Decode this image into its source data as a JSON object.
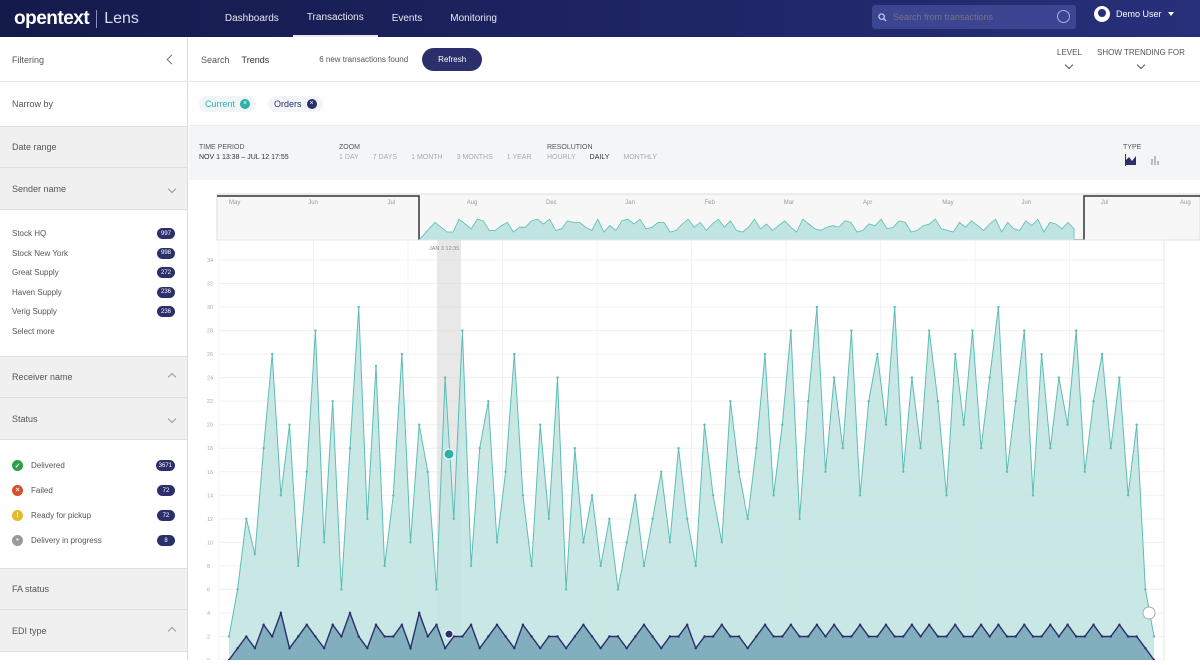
{
  "app": {
    "brand": "opentext",
    "product": "Lens"
  },
  "nav": {
    "items": [
      "Dashboards",
      "Transactions",
      "Events",
      "Monitoring"
    ],
    "active": 1
  },
  "search": {
    "placeholder": "Search from transactions"
  },
  "user": {
    "name": "Demo User"
  },
  "sidebar": {
    "title": "Filtering",
    "narrow_by": "Narrow by",
    "date_range": "Date range",
    "sender_name": "Sender name",
    "senders": [
      {
        "label": "Stock HQ",
        "count": "997"
      },
      {
        "label": "Stock New York",
        "count": "998"
      },
      {
        "label": "Great Supply",
        "count": "272"
      },
      {
        "label": "Haven Supply",
        "count": "236"
      },
      {
        "label": "Verig Supply",
        "count": "236"
      },
      {
        "label": "Select more",
        "count": ""
      }
    ],
    "receiver_name": "Receiver name",
    "status_title": "Status",
    "statuses": [
      {
        "label": "Delivered",
        "count": "3671",
        "color": "#2e9e47",
        "icon": "check-icon"
      },
      {
        "label": "Failed",
        "count": "72",
        "color": "#d9502f",
        "icon": "x-icon"
      },
      {
        "label": "Ready for pickup",
        "count": "72",
        "color": "#e6b82e",
        "icon": "info-icon"
      },
      {
        "label": "Delivery in progress",
        "count": "8",
        "color": "#9a9a9a",
        "icon": "progress-icon"
      }
    ],
    "fa_status": "FA status",
    "edi_type": "EDI type"
  },
  "toolbar": {
    "tabs": [
      "Search",
      "Trends"
    ],
    "new_transactions": "6 new transactions found",
    "refresh": "Refresh",
    "level": "LEVEL",
    "show_trending": "SHOW TRENDING FOR"
  },
  "filters": [
    {
      "label": "Current",
      "color": "#2fb0a8"
    },
    {
      "label": "Orders",
      "color": "#2b2f6b"
    }
  ],
  "controls": {
    "time_period_label": "TIME PERIOD",
    "time_period_value": "NOV 1 13:38 – JUL 12 17:55",
    "zoom_label": "ZOOM",
    "zoom_options": [
      "1 DAY",
      "7 DAYS",
      "1 MONTH",
      "3 MONTHS",
      "1 YEAR"
    ],
    "resolution_label": "RESOLUTION",
    "resolution_options": [
      "HOURLY",
      "DAILY",
      "MONTHLY"
    ],
    "resolution_selected": 1,
    "type_label": "TYPE"
  },
  "chart_data": {
    "type": "area",
    "overview_months": [
      "May",
      "Jun",
      "Jul",
      "Aug",
      "Dec",
      "Jan",
      "Feb",
      "Mar",
      "Apr",
      "May",
      "Jun",
      "Jul",
      "Aug"
    ],
    "cursor_label": "JAN 3 12:35",
    "ylim": [
      0,
      34
    ],
    "y_ticks": [
      0,
      2,
      4,
      6,
      8,
      10,
      12,
      14,
      16,
      18,
      20,
      22,
      24,
      26,
      28,
      30,
      32,
      34
    ],
    "series": [
      {
        "color": "#5dbdb5",
        "fill": "#bfe4e1",
        "values": [
          2,
          6,
          12,
          9,
          18,
          26,
          14,
          20,
          8,
          16,
          28,
          10,
          22,
          6,
          18,
          30,
          12,
          25,
          8,
          14,
          26,
          10,
          20,
          16,
          6,
          24,
          12,
          28,
          8,
          18,
          22,
          10,
          16,
          26,
          14,
          8,
          20,
          12,
          24,
          6,
          18,
          10,
          14,
          8,
          12,
          6,
          10,
          14,
          8,
          12,
          16,
          10,
          18,
          12,
          8,
          20,
          14,
          10,
          22,
          16,
          12,
          18,
          26,
          14,
          20,
          28,
          12,
          22,
          30,
          16,
          24,
          18,
          28,
          14,
          22,
          26,
          20,
          30,
          16,
          24,
          18,
          28,
          22,
          14,
          26,
          20,
          28,
          18,
          24,
          30,
          16,
          22,
          28,
          14,
          26,
          18,
          24,
          20,
          28,
          16,
          22,
          26,
          18,
          24,
          14,
          20,
          6,
          2
        ]
      },
      {
        "color": "#2b2f6b",
        "fill": "#7aa8b8",
        "values": [
          0,
          1,
          2,
          1,
          3,
          2,
          4,
          1,
          2,
          3,
          2,
          1,
          3,
          2,
          4,
          2,
          1,
          3,
          2,
          2,
          3,
          1,
          4,
          2,
          3,
          1,
          2,
          2,
          3,
          1,
          2,
          3,
          2,
          1,
          3,
          2,
          1,
          2,
          2,
          1,
          2,
          3,
          2,
          1,
          2,
          2,
          1,
          2,
          3,
          2,
          1,
          2,
          2,
          3,
          1,
          2,
          2,
          3,
          2,
          2,
          1,
          2,
          3,
          2,
          2,
          3,
          2,
          2,
          3,
          2,
          3,
          2,
          2,
          3,
          2,
          2,
          3,
          2,
          2,
          3,
          2,
          3,
          2,
          2,
          3,
          2,
          2,
          3,
          2,
          3,
          2,
          2,
          3,
          2,
          2,
          3,
          2,
          3,
          2,
          2,
          3,
          2,
          2,
          3,
          2,
          2,
          1,
          0
        ]
      }
    ]
  }
}
